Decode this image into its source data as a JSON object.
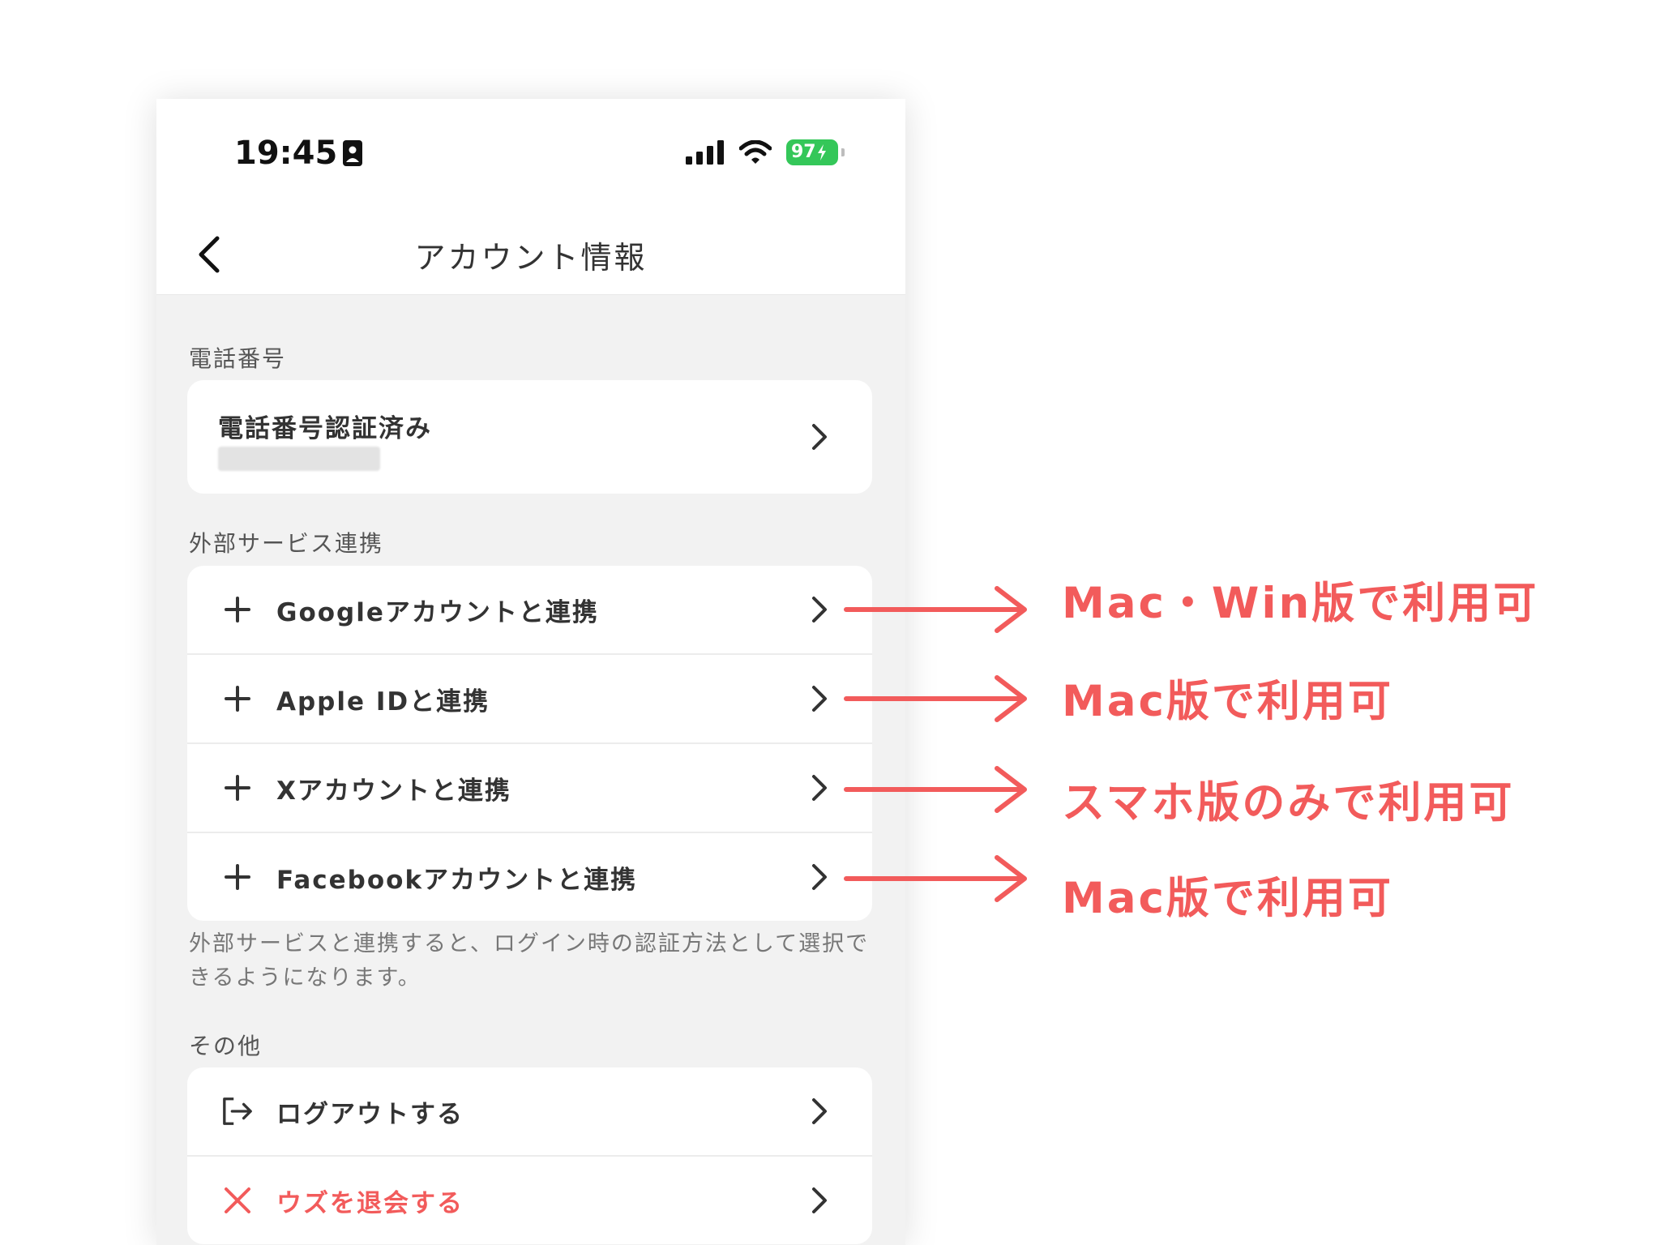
{
  "status_bar": {
    "time": "19:45",
    "battery": "97"
  },
  "nav": {
    "title": "アカウント情報"
  },
  "phone_section": {
    "label": "電話番号",
    "row_title": "電話番号認証済み"
  },
  "external_section": {
    "label": "外部サービス連携",
    "rows": [
      {
        "label": "Googleアカウントと連携"
      },
      {
        "label": "Apple IDと連携"
      },
      {
        "label": "Xアカウントと連携"
      },
      {
        "label": "Facebookアカウントと連携"
      }
    ],
    "note": "外部サービスと連携すると、ログイン時の認証方法として選択できるようになります。"
  },
  "other_section": {
    "label": "その他",
    "rows": [
      {
        "label": "ログアウトする"
      },
      {
        "label": "ウズを退会する"
      }
    ]
  },
  "annotations": [
    "Mac・Win版で利用可",
    "Mac版で利用可",
    "スマホ版のみで利用可",
    "Mac版で利用可"
  ],
  "colors": {
    "accent": "#f25b5b",
    "battery": "#34c759",
    "background": "#f2f2f2"
  }
}
